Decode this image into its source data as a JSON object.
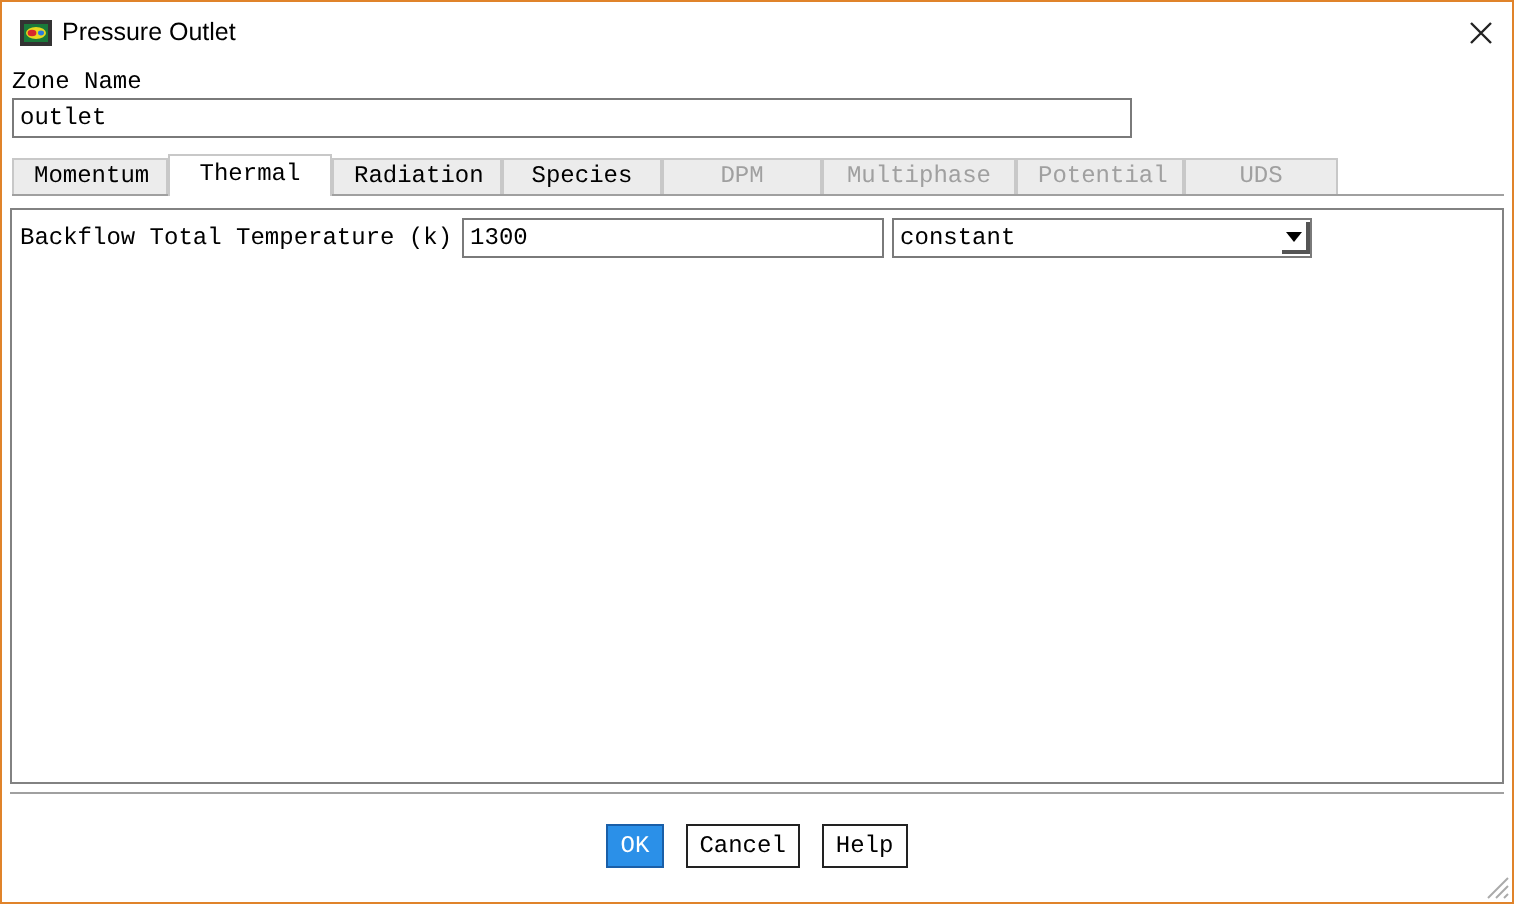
{
  "window": {
    "title": "Pressure Outlet"
  },
  "zone_name": {
    "label": "Zone Name",
    "value": "outlet"
  },
  "tabs": [
    {
      "label": "Momentum",
      "selected": false,
      "disabled": false
    },
    {
      "label": "Thermal",
      "selected": true,
      "disabled": false
    },
    {
      "label": "Radiation",
      "selected": false,
      "disabled": false
    },
    {
      "label": "Species",
      "selected": false,
      "disabled": false
    },
    {
      "label": "DPM",
      "selected": false,
      "disabled": true
    },
    {
      "label": "Multiphase",
      "selected": false,
      "disabled": true
    },
    {
      "label": "Potential",
      "selected": false,
      "disabled": true
    },
    {
      "label": "UDS",
      "selected": false,
      "disabled": true
    }
  ],
  "fields": [
    {
      "label": "Backflow Total Temperature (k)",
      "value": "1300",
      "option": "constant"
    }
  ],
  "buttons": [
    {
      "label": "OK",
      "selected": true
    },
    {
      "label": "Cancel",
      "selected": false
    },
    {
      "label": "Help",
      "selected": false
    }
  ]
}
